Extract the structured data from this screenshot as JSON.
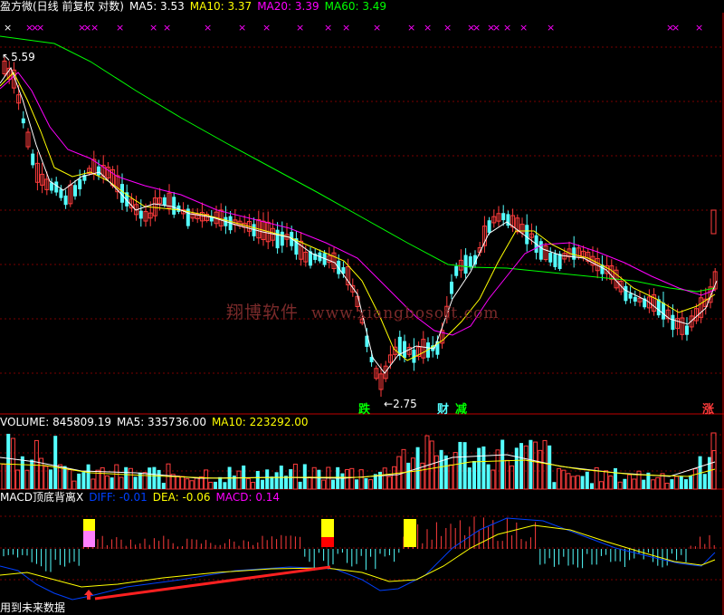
{
  "colors": {
    "background": "#000000",
    "up": "#ff3c3c",
    "down": "#54ffff",
    "ma5": "#ffffff",
    "ma10": "#ffff00",
    "ma20": "#ff00ff",
    "ma60": "#00ff00",
    "grid": "#7a0000",
    "diff": "#0040ff",
    "dea": "#ffff00"
  },
  "price_header": {
    "title": "盈方微(日线 前复权 对数)",
    "ma5": "MA5: 3.53",
    "ma10": "MA10: 3.37",
    "ma20": "MA20: 3.39",
    "ma60": "MA60: 3.49"
  },
  "volume_header": {
    "title": "VOLUME: 845809.19",
    "ma5": "MA5: 335736.00",
    "ma10": "MA10: 223292.00"
  },
  "macd_header": {
    "title": "MACD顶底背离X",
    "diff": "DIFF: -0.01",
    "dea": "DEA: -0.06",
    "macd": "MACD: 0.14"
  },
  "annotations": {
    "high": "5.59",
    "low": "2.75",
    "tag_die": "跌",
    "tag_cai": "财",
    "tag_jian": "减",
    "tag_zhang": "涨",
    "footer": "用到未来数据"
  },
  "watermark": {
    "cn": "翔博软件",
    "url": "www.xiangbosoft.com"
  },
  "chart_data": {
    "type": "candlestick",
    "yscale": "log",
    "ylim": [
      2.6,
      6.0
    ],
    "series": [
      {
        "name": "MA5",
        "values": [
          3.53
        ]
      },
      {
        "name": "MA10",
        "values": [
          3.37
        ]
      },
      {
        "name": "MA20",
        "values": [
          3.39
        ]
      },
      {
        "name": "MA60",
        "values": [
          3.49
        ]
      }
    ],
    "volume": {
      "VOLUME": 845809.19,
      "MA5": 335736.0,
      "MA10": 223292.0
    },
    "macd": {
      "DIFF": -0.01,
      "DEA": -0.06,
      "MACD": 0.14
    },
    "grid": true
  }
}
